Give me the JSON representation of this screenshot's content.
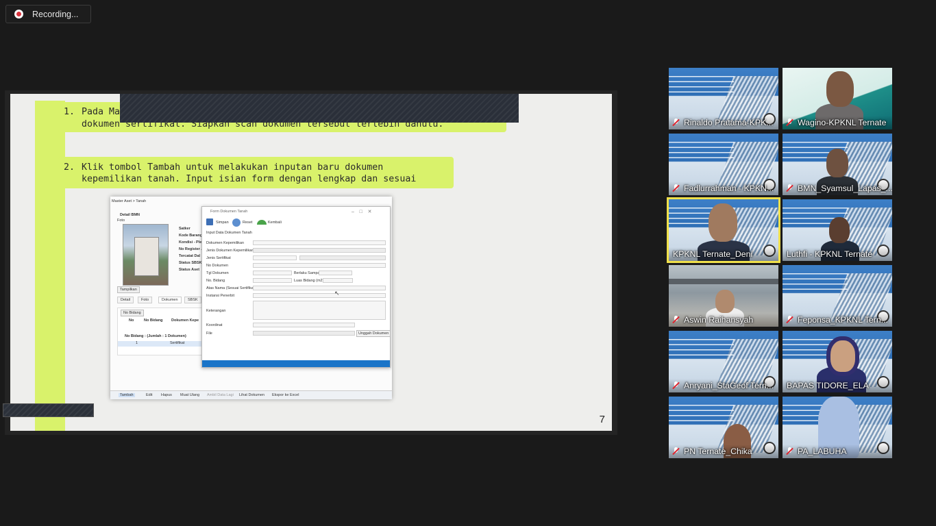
{
  "recording": {
    "label": "Recording..."
  },
  "slide": {
    "item1_num": "1.",
    "item1_line1": "Pada Ma",
    "item1_line2": "dokumen sertifikat. Siapkan scan dokumen tersebut terlebih dahulu.",
    "item2_num": "2.",
    "item2_line1": "Klik tombol Tambah untuk melakukan inputan baru dokumen",
    "item2_line2": "kepemilikan tanah. Input isian form dengan lengkap dan sesuai",
    "page_number": "7"
  },
  "screenshot": {
    "breadcrumb": "Master Aset > Tanah",
    "detail_title": "Detail BMN",
    "foto_label": "Foto",
    "fields": [
      "Satker",
      "Kode Barang",
      "Kondisi - Pleno",
      "No Register A",
      "Tercatat Dal",
      "Status SBSK",
      "Status Aset"
    ],
    "tampilkan": "Tampilkan",
    "tabs": [
      "Detail",
      "Foto",
      "Dokumen",
      "SBSK"
    ],
    "group_chip": "No Bidang",
    "grid_headers": [
      "No",
      "No Bidang",
      "Dokumen Kepe"
    ],
    "grid_group": "No Bidang : (Jumlah : 1 Dokumen)",
    "grid_row_no": "1",
    "grid_row_val": "Sertifikat",
    "bottom_actions": [
      "Tambah",
      "Edit",
      "Hapus",
      "Muat Ulang",
      "Ambil Data Lagi",
      "Lihat Dokumen",
      "Ekspor ke Excel"
    ],
    "dialog": {
      "title": "Form Dokumen Tanah",
      "toolbar": [
        "Simpan",
        "Reset",
        "Kembali"
      ],
      "section": "Input Data Dokumen Tanah",
      "labels": [
        "Dokumen Kepemilikan",
        "Jenis Dokumen Kepemilikan",
        "Jenis Sertifikat",
        "No Dokumen",
        "Tgl Dokumen",
        "No. Bidang",
        "Atas Nama (Sesuai Sertifikat)",
        "Instansi Penerbit",
        "Keterangan",
        "Koordinat",
        "File"
      ],
      "berlaku_label": "Berlaku Sampai",
      "luas_label": "Luas Bidang (m2)",
      "upload_button": "Unggah Dokumen"
    }
  },
  "participants": [
    {
      "name": "Rinaldo Pratama-KPK..."
    },
    {
      "name": "Wagino-KPKNL Ternate"
    },
    {
      "name": "Fadlurrahman - KPKN..."
    },
    {
      "name": "BMN_Syamsul_Lapas_..."
    },
    {
      "name": "KPKNL Ternate_Deni"
    },
    {
      "name": "Luthfi - KPKNL Ternate"
    },
    {
      "name": "Aswin Raihansyah"
    },
    {
      "name": "Feponsa_KPKNL Tern..."
    },
    {
      "name": "Anryani_StaGeof Tern..."
    },
    {
      "name": "BAPAS TIDORE_ELA"
    },
    {
      "name": "PN Ternate_Chika"
    },
    {
      "name": "PA_LABUHA"
    }
  ],
  "colors": {
    "lime": "#d9f26b",
    "active_speaker": "#f0e04a",
    "muted_red": "#e0232d",
    "record_red": "#d9333c"
  }
}
